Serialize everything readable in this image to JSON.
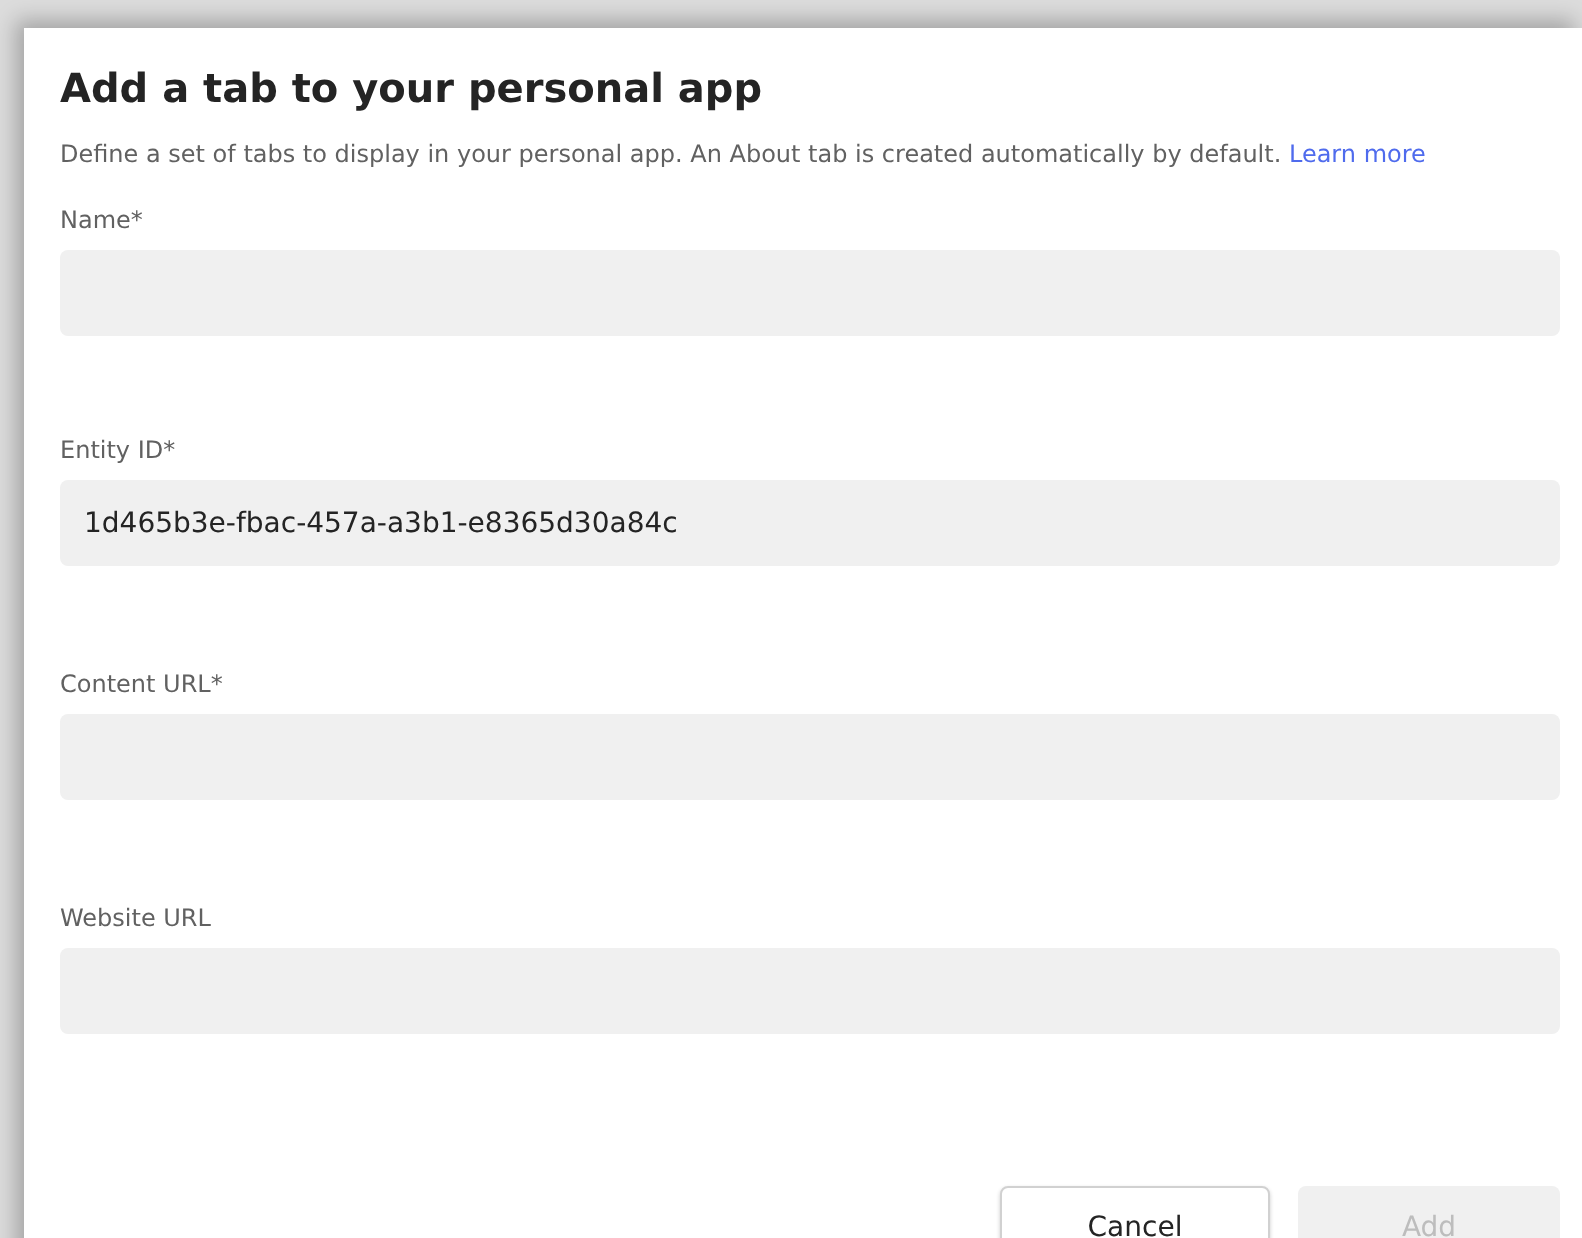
{
  "dialog": {
    "title": "Add a tab to your personal app",
    "description": "Define a set of tabs to display in your personal app. An About tab is created automatically by default.",
    "learn_more": "Learn more"
  },
  "fields": [
    {
      "label": "Name*"
    },
    {
      "label": "Entity ID*",
      "value": "1d465b3e-fbac-457a-a3b1-e8365d30a84c"
    },
    {
      "label": "Content URL*"
    },
    {
      "label": "Website URL"
    }
  ],
  "buttons": [
    {
      "label": "Cancel",
      "disabled": false
    },
    {
      "label": "Add",
      "disabled": true
    }
  ]
}
